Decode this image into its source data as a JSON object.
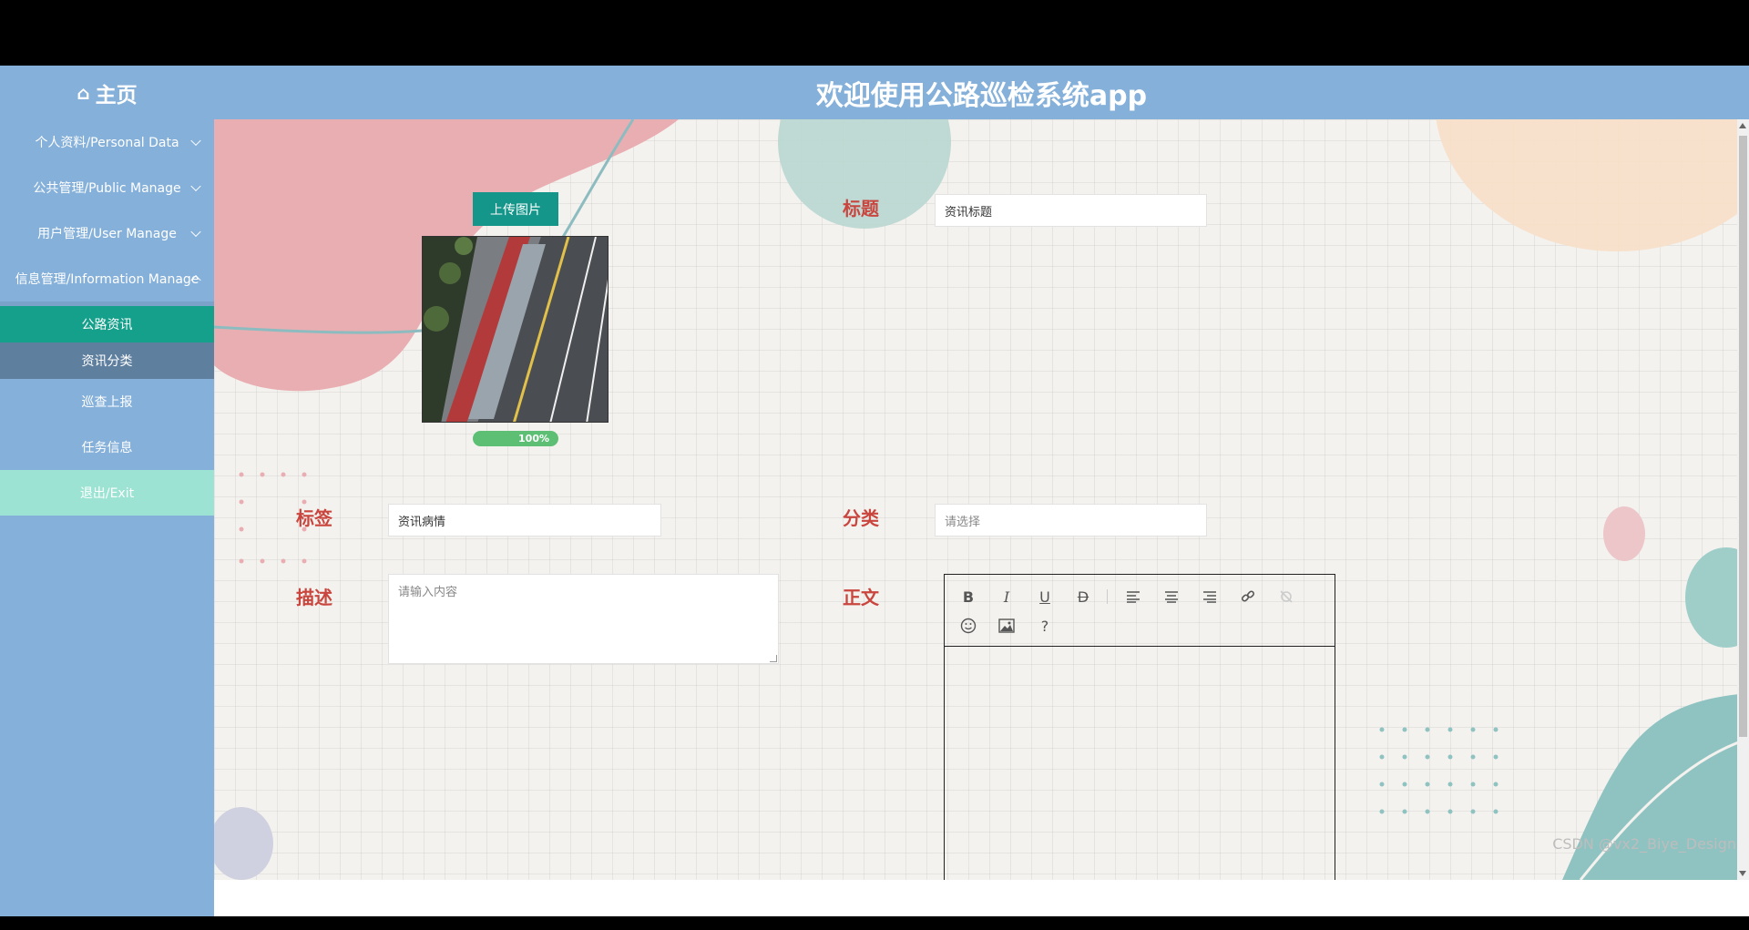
{
  "header": {
    "home_label": "主页",
    "app_title": "欢迎使用公路巡检系统app"
  },
  "sidebar": {
    "items": [
      {
        "label": "个人资料/Personal Data"
      },
      {
        "label": "公共管理/Public Manage"
      },
      {
        "label": "用户管理/User Manage"
      },
      {
        "label": "信息管理/Information Manage"
      }
    ],
    "sub_items": [
      {
        "label": "公路资讯"
      },
      {
        "label": "资讯分类"
      }
    ],
    "more_items": [
      {
        "label": "巡查上报"
      },
      {
        "label": "任务信息"
      }
    ],
    "exit_label": "退出/Exit"
  },
  "form": {
    "upload_label": "上传图片",
    "progress_label": "100%",
    "progress_value": 1.0,
    "title_label": "标题",
    "title_value": "资讯标题",
    "tag_label": "标签",
    "tag_value": "资讯病情",
    "category_label": "分类",
    "category_placeholder": "请选择",
    "desc_label": "描述",
    "desc_placeholder": "请输入内容",
    "body_label": "正文"
  },
  "editor_toolbar": {
    "bold": "B",
    "italic": "I",
    "underline": "U",
    "strike": "D",
    "help": "?"
  },
  "watermark": "CSDN @vx2_Biye_Design",
  "colors": {
    "header_bg": "#85b0d9",
    "sidebar_bg": "#85b0d9",
    "active_sub": "#14a08b",
    "exit_bg": "#9ce3d3",
    "label_red": "#c9463f",
    "upload_btn": "#14968a",
    "progress": "#5cbf74"
  }
}
